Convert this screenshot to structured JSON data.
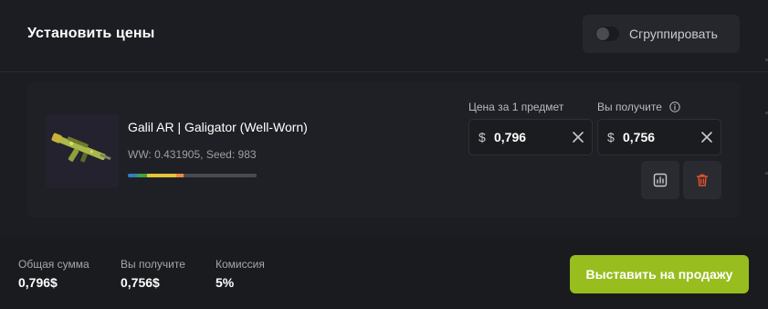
{
  "header": {
    "title": "Установить цены",
    "group_toggle_label": "Сгруппировать"
  },
  "item": {
    "name": "Galil AR | Galigator (Well-Worn)",
    "wear_info": "WW: 0.431905, Seed: 983",
    "wear_value": 0.431905,
    "price_label": "Цена за 1 предмет",
    "receive_label": "Вы получите",
    "price_currency": "$",
    "price_value": "0,796",
    "receive_currency": "$",
    "receive_value": "0,756"
  },
  "footer": {
    "total_label": "Общая сумма",
    "total_value": "0,796$",
    "receive_label": "Вы получите",
    "receive_value": "0,756$",
    "commission_label": "Комиссия",
    "commission_value": "5%",
    "sell_button": "Выставить на продажу"
  },
  "colors": {
    "accent": "#98bd1e",
    "delete": "#e0532a",
    "wear_fn": "#2f7fc3",
    "wear_mw": "#3fa04a",
    "wear_ft": "#e3c43a",
    "wear_ww": "#f08a3c",
    "wear_bs": "#4a4b52"
  },
  "icons": {
    "info": "info-icon",
    "chart": "chart-icon",
    "trash": "trash-icon",
    "clear": "close-icon"
  }
}
